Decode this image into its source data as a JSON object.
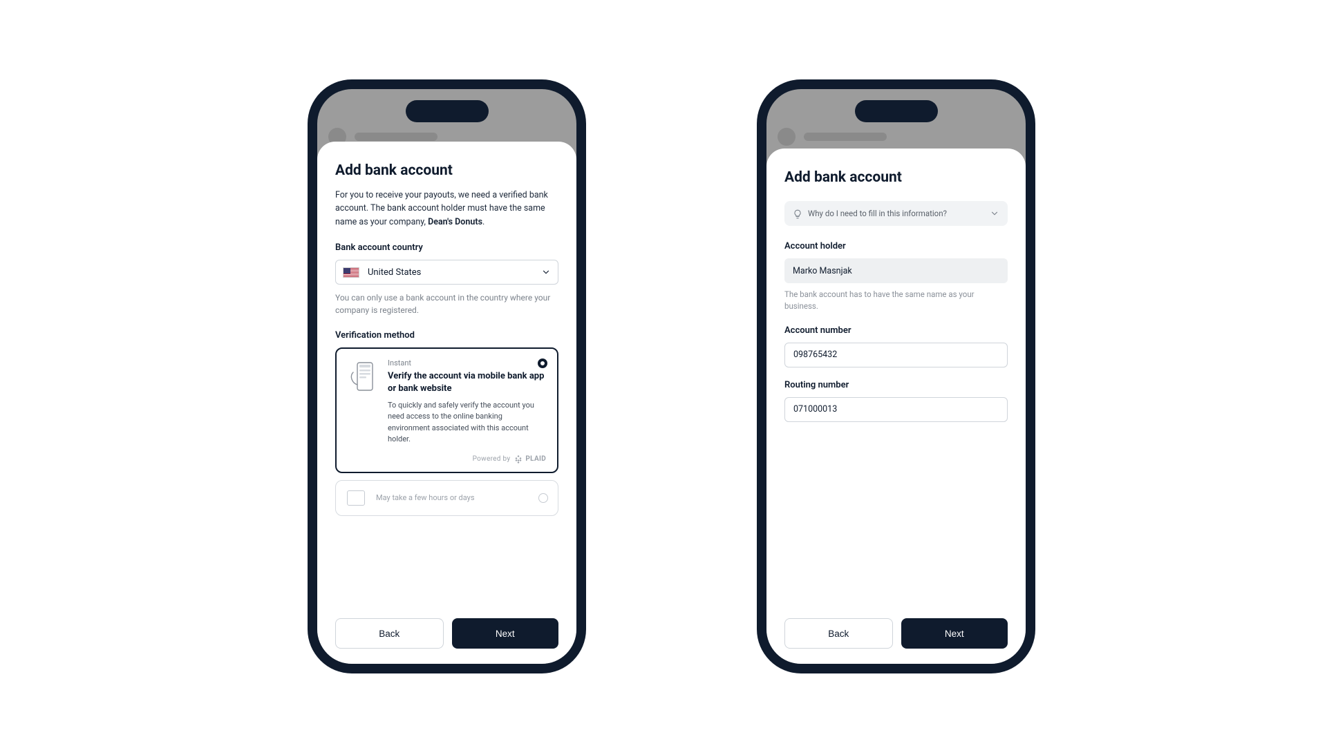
{
  "left": {
    "title": "Add bank account",
    "intro_part1": "For you to receive your payouts, we need a verified bank account. The bank account holder must have the same name as your company, ",
    "intro_bold": "Dean's Donuts",
    "intro_part2": ".",
    "country_label": "Bank account country",
    "country_value": "United States",
    "country_hint": "You can only use a bank account in the country where your company is registered.",
    "method_label": "Verification method",
    "method_instant_badge": "Instant",
    "method_instant_title": "Verify the account via mobile bank app or bank website",
    "method_instant_desc": "To quickly and safely verify the account you need access to the online banking environment associated with this account holder.",
    "powered_by_label": "Powered by",
    "powered_by_name": "PLAID",
    "method_alt_badge": "May take a few hours or days",
    "back": "Back",
    "next": "Next"
  },
  "right": {
    "title": "Add bank account",
    "info_question": "Why do I need to fill in this information?",
    "holder_label": "Account holder",
    "holder_value": "Marko Masnjak",
    "holder_hint": "The bank account has to have the same name as your business.",
    "account_number_label": "Account number",
    "account_number_value": "098765432",
    "routing_number_label": "Routing number",
    "routing_number_value": "071000013",
    "back": "Back",
    "next": "Next"
  }
}
